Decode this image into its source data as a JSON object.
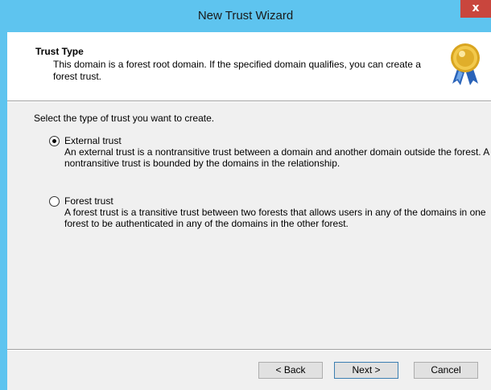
{
  "window": {
    "title": "New Trust Wizard",
    "close_label": "x"
  },
  "header": {
    "title": "Trust Type",
    "description": "This domain is a forest root domain. If the specified domain qualifies, you can create a forest trust.",
    "icon": "award-medal-icon"
  },
  "main": {
    "prompt": "Select the type of trust you want to create.",
    "options": [
      {
        "label": "External trust",
        "description": "An external trust is a nontransitive trust between a domain and another domain outside the forest. A nontransitive trust is bounded by the domains in the relationship.",
        "selected": true
      },
      {
        "label": "Forest trust",
        "description": "A forest trust is a transitive trust between two forests that allows users in any of the domains in one forest to be authenticated in any of the domains in the other forest.",
        "selected": false
      }
    ]
  },
  "footer": {
    "back_label": "< Back",
    "next_label": "Next >",
    "cancel_label": "Cancel"
  },
  "colors": {
    "frame": "#5ec4ef",
    "close": "#c9463d",
    "dialog_bg": "#f0f0f0"
  }
}
